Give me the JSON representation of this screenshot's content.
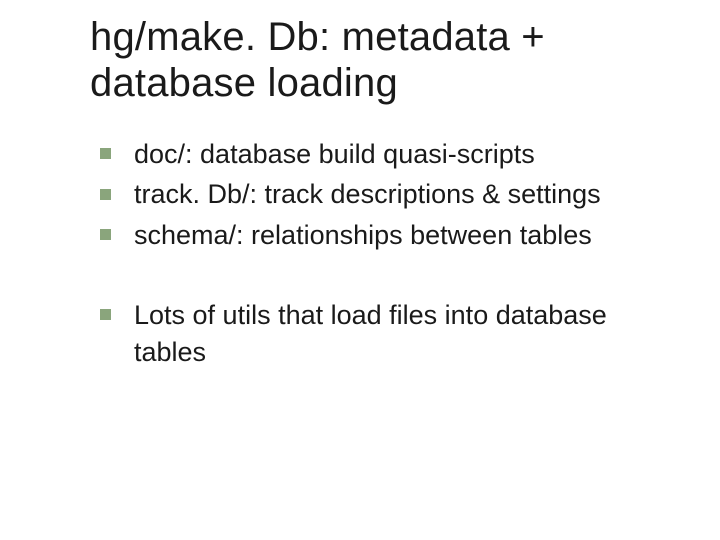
{
  "title": "hg/make. Db: metadata + database loading",
  "bullets_group1": [
    "doc/: database build quasi-scripts",
    "track. Db/: track descriptions & settings",
    "schema/: relationships between tables"
  ],
  "bullets_group2": [
    "Lots of utils that load files into database tables"
  ],
  "bullet_color": "#8aa57c"
}
